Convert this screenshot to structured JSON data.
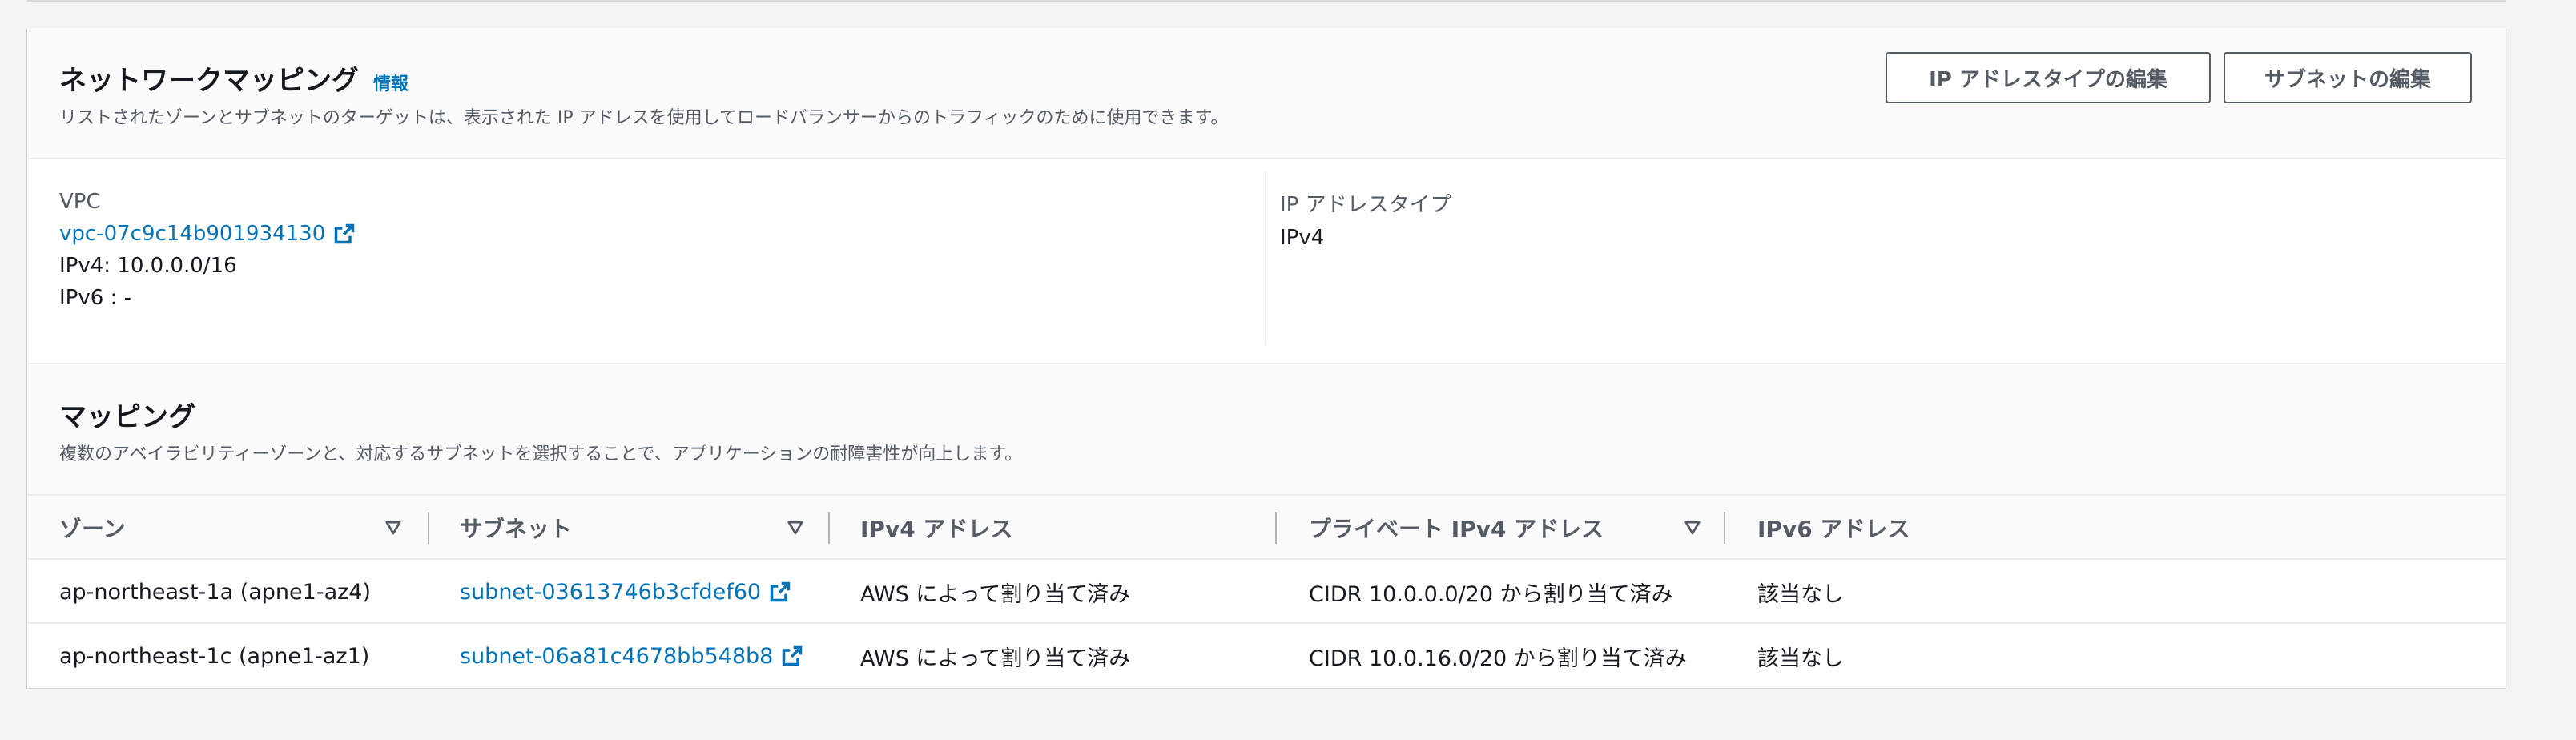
{
  "network_mapping": {
    "title": "ネットワークマッピング",
    "info_label": "情報",
    "description": "リストされたゾーンとサブネットのターゲットは、表示された IP アドレスを使用してロードバランサーからのトラフィックのために使用できます。",
    "edit_ip_type_button": "IP アドレスタイプの編集",
    "edit_subnets_button": "サブネットの編集"
  },
  "vpc": {
    "label": "VPC",
    "id": "vpc-07c9c14b901934130",
    "ipv4": "IPv4: 10.0.0.0/16",
    "ipv6": "IPv6 : -"
  },
  "ip_address_type": {
    "label": "IP アドレスタイプ",
    "value": "IPv4"
  },
  "mappings": {
    "title": "マッピング",
    "description": "複数のアベイラビリティーゾーンと、対応するサブネットを選択することで、アプリケーションの耐障害性が向上します。",
    "columns": {
      "zone": "ゾーン",
      "subnet": "サブネット",
      "ipv4": "IPv4 アドレス",
      "private_ipv4": "プライベート IPv4 アドレス",
      "ipv6": "IPv6 アドレス"
    },
    "rows": [
      {
        "zone": "ap-northeast-1a (apne1-az4)",
        "subnet": "subnet-03613746b3cfdef60",
        "ipv4": "AWS によって割り当て済み",
        "private_ipv4": "CIDR 10.0.0.0/20 から割り当て済み",
        "ipv6": "該当なし"
      },
      {
        "zone": "ap-northeast-1c (apne1-az1)",
        "subnet": "subnet-06a81c4678bb548b8",
        "ipv4": "AWS によって割り当て済み",
        "private_ipv4": "CIDR 10.0.16.0/20 から割り当て済み",
        "ipv6": "該当なし"
      }
    ]
  },
  "colors": {
    "link": "#0073bb",
    "text": "#16191f",
    "secondary_text": "#545b64",
    "border": "#eaeded",
    "page_bg": "#f2f3f3"
  }
}
